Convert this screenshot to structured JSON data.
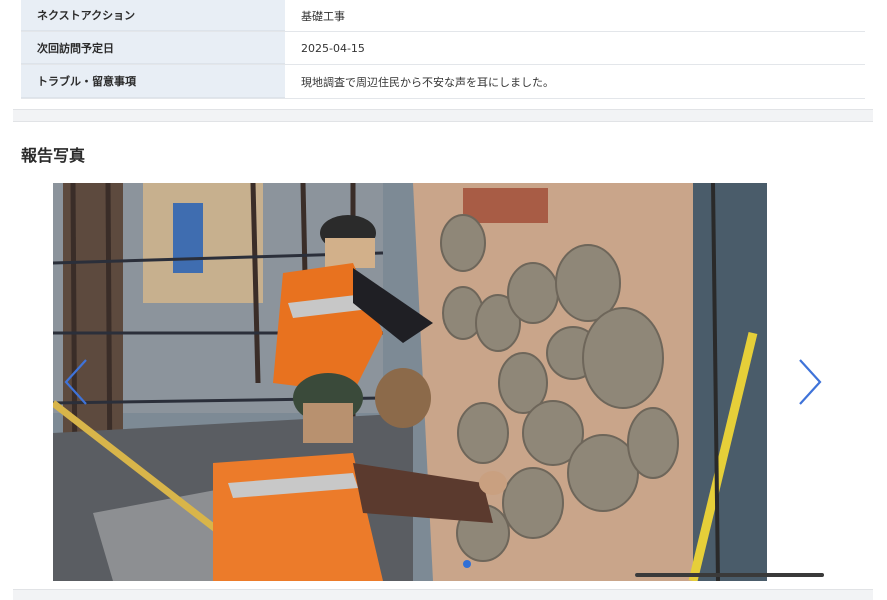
{
  "details": [
    {
      "label": "ネクストアクション",
      "value": "基礎工事"
    },
    {
      "label": "次回訪問予定日",
      "value": "2025-04-15"
    },
    {
      "label": "トラブル・留意事項",
      "value": "現地調査で周辺住民から不安な声を耳にしました。"
    }
  ],
  "photos": {
    "title": "報告写真",
    "current_index": 1,
    "total": 1,
    "scroll_progress": 1.0,
    "accent_color": "#2f6fd6"
  },
  "icons": {
    "prev": "chevron-left-icon",
    "next": "chevron-right-icon"
  }
}
